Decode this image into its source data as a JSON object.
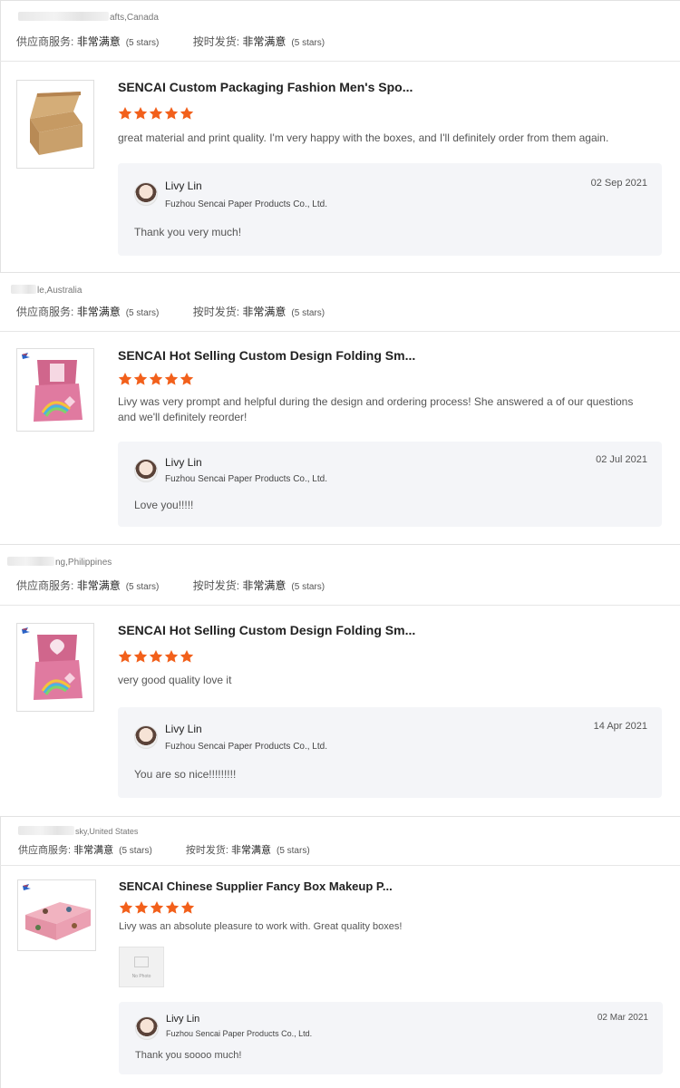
{
  "reviews": [
    {
      "buyer_suffix": "afts,Canada",
      "service_label": "供应商服务:",
      "service_value": "非常满意",
      "service_stars": "(5 stars)",
      "shipping_label": "按时发货:",
      "shipping_value": "非常满意",
      "shipping_stars": "(5 stars)",
      "product_title": "SENCAI Custom Packaging Fashion Men's Spo...",
      "rating": 5,
      "comment": "great material and print quality. I'm very happy with the boxes, and I'll definitely order from them again.",
      "reply": {
        "name": "Livy Lin",
        "company": "Fuzhou Sencai Paper Products Co., Ltd.",
        "date": "02 Sep 2021",
        "text": "Thank you very much!"
      }
    },
    {
      "buyer_suffix": "le,Australia",
      "service_label": "供应商服务:",
      "service_value": "非常满意",
      "service_stars": "(5 stars)",
      "shipping_label": "按时发货:",
      "shipping_value": "非常满意",
      "shipping_stars": "(5 stars)",
      "product_title": "SENCAI Hot Selling Custom Design Folding Sm...",
      "rating": 5,
      "comment": "Livy was very prompt and helpful during the design and ordering process! She answered a of our questions and we'll definitely reorder!",
      "reply": {
        "name": "Livy Lin",
        "company": "Fuzhou Sencai Paper Products Co., Ltd.",
        "date": "02 Jul 2021",
        "text": "Love you!!!!!"
      }
    },
    {
      "buyer_suffix": "ng,Philippines",
      "service_label": "供应商服务:",
      "service_value": "非常满意",
      "service_stars": "(5 stars)",
      "shipping_label": "按时发货:",
      "shipping_value": "非常满意",
      "shipping_stars": "(5 stars)",
      "product_title": "SENCAI Hot Selling Custom Design Folding Sm...",
      "rating": 5,
      "comment": "very good  quality  love it",
      "reply": {
        "name": "Livy Lin",
        "company": "Fuzhou Sencai Paper Products Co., Ltd.",
        "date": "14 Apr 2021",
        "text": "You are so nice!!!!!!!!!"
      }
    },
    {
      "buyer_suffix": "sky,United States",
      "service_label": "供应商服务:",
      "service_value": "非常满意",
      "service_stars": "(5 stars)",
      "shipping_label": "按时发货:",
      "shipping_value": "非常满意",
      "shipping_stars": "(5 stars)",
      "product_title": "SENCAI Chinese Supplier Fancy Box Makeup P...",
      "rating": 5,
      "comment": "Livy was an absolute pleasure to work with. Great quality boxes!",
      "attachment_label": "No Photo",
      "reply": {
        "name": "Livy Lin",
        "company": "Fuzhou Sencai Paper Products Co., Ltd.",
        "date": "02 Mar 2021",
        "text": "Thank you soooo much!"
      }
    }
  ],
  "colors": {
    "star": "#f2601b",
    "reply_bg": "#f4f5f8"
  },
  "icons": {
    "star": "star-icon",
    "avatar": "avatar"
  }
}
